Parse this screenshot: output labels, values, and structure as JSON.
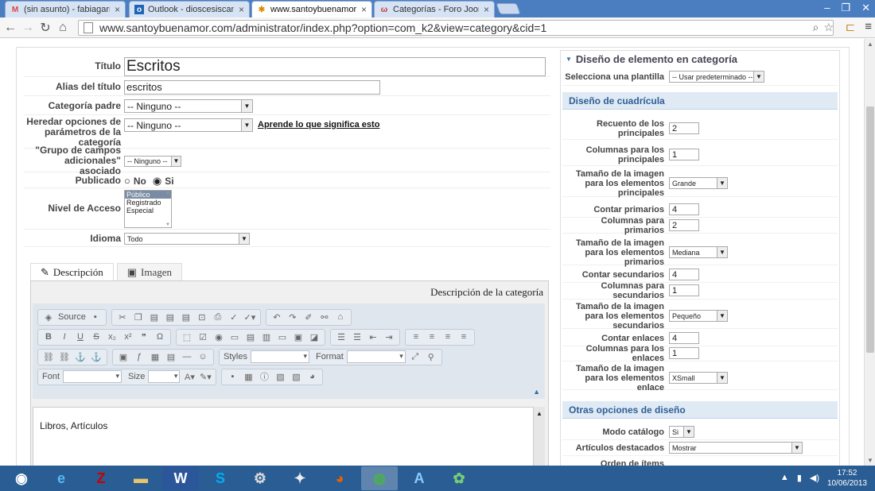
{
  "browser": {
    "tabs": [
      {
        "label": "(sin asunto) - fabiagarre@",
        "icon": "gmail-icon",
        "color": "#d44"
      },
      {
        "label": "Outlook - dioscesiscanelo",
        "icon": "outlook-icon",
        "color": "#1e65b5"
      },
      {
        "label": "www.santoybuenamor.com",
        "icon": "joomla-icon",
        "color": "#e58a00"
      },
      {
        "label": "Categorías - Foro Joomla!",
        "icon": "forum-icon",
        "color": "#c33"
      }
    ],
    "url": "www.santoybuenamor.com/administrator/index.php?option=com_k2&view=category&cid=1"
  },
  "form": {
    "title_label": "Título",
    "title_value": "Escritos",
    "alias_label": "Alias del título",
    "alias_value": "escritos",
    "parent_label": "Categoría padre",
    "parent_value": "-- Ninguno --",
    "inherit_label": "Heredar opciones de parámetros de la categoría",
    "inherit_value": "-- Ninguno --",
    "inherit_link": "Aprende lo que significa esto",
    "extra_label": "\"Grupo de campos adicionales\" asociado",
    "extra_value": "-- Ninguno --",
    "published_label": "Publicado",
    "no": "No",
    "yes": "Si",
    "access_label": "Nivel de Acceso",
    "access_options": [
      "Público",
      "Registrado",
      "Especial"
    ],
    "language_label": "Idioma",
    "language_value": "Todo"
  },
  "editor": {
    "tab_desc": "Descripción",
    "tab_image": "Imagen",
    "heading": "Descripción de la categoría",
    "source": "Source",
    "styles": "Styles",
    "format": "Format",
    "font": "Font",
    "size": "Size",
    "content": "Libros, Artículos"
  },
  "layout": {
    "header": "Diseño de elemento en categoría",
    "template_label": "Selecciona una plantilla",
    "template_value": "-- Usar predeterminado --",
    "grid_band": "Diseño de cuadrícula",
    "rows": [
      {
        "label": "Recuento de los principales",
        "value": "2",
        "type": "input"
      },
      {
        "label": "Columnas para los principales",
        "value": "1",
        "type": "input"
      },
      {
        "label": "Tamaño de la imagen para los elementos principales",
        "value": "Grande",
        "type": "select"
      },
      {
        "label": "Contar primarios",
        "value": "4",
        "type": "input"
      },
      {
        "label": "Columnas para primarios",
        "value": "2",
        "type": "input"
      },
      {
        "label": "Tamaño de la imagen para los elementos primarios",
        "value": "Mediana",
        "type": "select"
      },
      {
        "label": "Contar secundarios",
        "value": "4",
        "type": "input"
      },
      {
        "label": "Columnas para secundarios",
        "value": "1",
        "type": "input"
      },
      {
        "label": "Tamaño de la imagen para los elementos secundarios",
        "value": "Pequeño",
        "type": "select"
      },
      {
        "label": "Contar enlaces",
        "value": "4",
        "type": "input"
      },
      {
        "label": "Columnas para los enlaces",
        "value": "1",
        "type": "input"
      },
      {
        "label": "Tamaño de la imagen para los elementos enlace",
        "value": "XSmall",
        "type": "select"
      }
    ],
    "other_band": "Otras opciones de diseño",
    "catalog_label": "Modo catálogo",
    "catalog_value": "Si",
    "featured_label": "Artículos destacados",
    "featured_value": "Mostrar",
    "order_label": "Orden de ítems"
  },
  "taskbar": {
    "time": "17:52",
    "date": "10/06/2013"
  }
}
